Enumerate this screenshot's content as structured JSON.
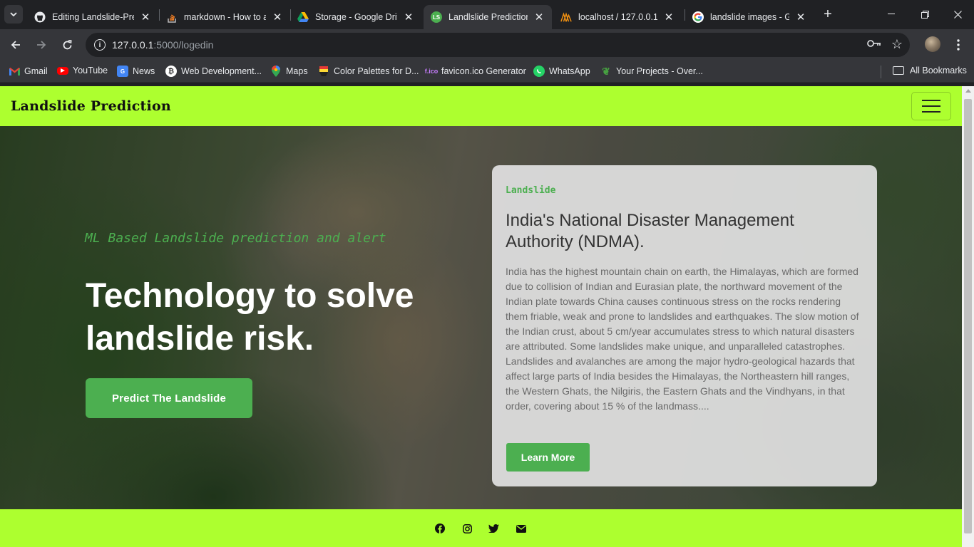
{
  "browser": {
    "tabs": [
      {
        "title": "Editing Landslide-Pre",
        "icon": "github-icon"
      },
      {
        "title": "markdown - How to a",
        "icon": "stackoverflow-icon"
      },
      {
        "title": "Storage - Google Driv",
        "icon": "google-drive-icon"
      },
      {
        "title": "Landlslide Prediction",
        "icon": "ls-icon",
        "active": true
      },
      {
        "title": "localhost / 127.0.0.1 /",
        "icon": "phpmyadmin-icon"
      },
      {
        "title": "landslide images - Go",
        "icon": "google-icon"
      }
    ],
    "address": {
      "host": "127.0.0.1",
      "path": ":5000/logedin"
    },
    "bookmarks": [
      {
        "label": "Gmail",
        "icon": "gmail-icon"
      },
      {
        "label": "YouTube",
        "icon": "youtube-icon"
      },
      {
        "label": "News",
        "icon": "news-icon"
      },
      {
        "label": "Web Development...",
        "icon": "webdev-icon"
      },
      {
        "label": "Maps",
        "icon": "maps-icon"
      },
      {
        "label": "Color Palettes for D...",
        "icon": "palette-icon"
      },
      {
        "label": "favicon.ico Generator",
        "icon": "favicon-icon"
      },
      {
        "label": "WhatsApp",
        "icon": "whatsapp-icon"
      },
      {
        "label": "Your Projects - Over...",
        "icon": "overleaf-icon"
      }
    ],
    "all_bookmarks": "All Bookmarks"
  },
  "site": {
    "brand": "Landslide Prediction",
    "hero": {
      "subtitle": "ML Based Landslide prediction and alert",
      "title": "Technology to solve landslide risk.",
      "button": "Predict The Landslide"
    },
    "card": {
      "label": "Landslide",
      "title": "India's National Disaster Management Authority (NDMA).",
      "text": "India has the highest mountain chain on earth, the Himalayas, which are formed due to collision of Indian and Eurasian plate, the northward movement of the Indian plate towards China causes continuous stress on the rocks rendering them friable, weak and prone to landslides and earthquakes. The slow motion of the Indian crust, about 5 cm/year accumulates stress to which natural disasters are attributed. Some landslides make unique, and unparalleled catastrophes. Landslides and avalanches are among the major hydro-geological hazards that affect large parts of India besides the Himalayas, the Northeastern hill ranges, the Western Ghats, the Nilgiris, the Eastern Ghats and the Vindhyans, in that order, covering about 15 % of the landmass....",
      "button": "Learn More"
    },
    "footer_icons": [
      "facebook-icon",
      "instagram-icon",
      "twitter-icon",
      "email-icon"
    ]
  },
  "colors": {
    "accent_lime": "#adff2f",
    "accent_green": "#4caf50"
  }
}
